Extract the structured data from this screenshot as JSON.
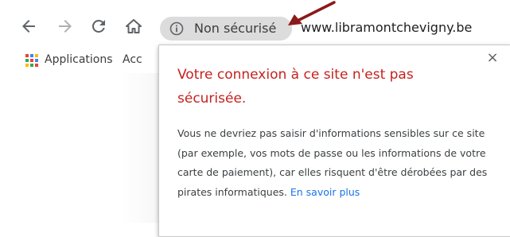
{
  "toolbar": {
    "back_icon": "arrow-left-icon",
    "forward_icon": "arrow-right-icon",
    "reload_icon": "reload-icon",
    "home_icon": "home-icon",
    "security_label": "Non sécurisé",
    "url": "www.libramontchevigny.be",
    "arrow_color": "#8b1a1a"
  },
  "bookmarks": {
    "apps_label": "Applications",
    "truncated_label": "Acc"
  },
  "popup": {
    "title": "Votre connexion à ce site n'est pas sécurisée.",
    "body": "Vous ne devriez pas saisir d'informations sensibles sur ce site (par exemple, vos mots de passe ou les informations de votre carte de paiement), car elles risquent d'être dérobées par des pirates informatiques.",
    "link": "En savoir plus",
    "close_symbol": "×",
    "title_color": "#c5221f",
    "link_color": "#1a73e8"
  }
}
